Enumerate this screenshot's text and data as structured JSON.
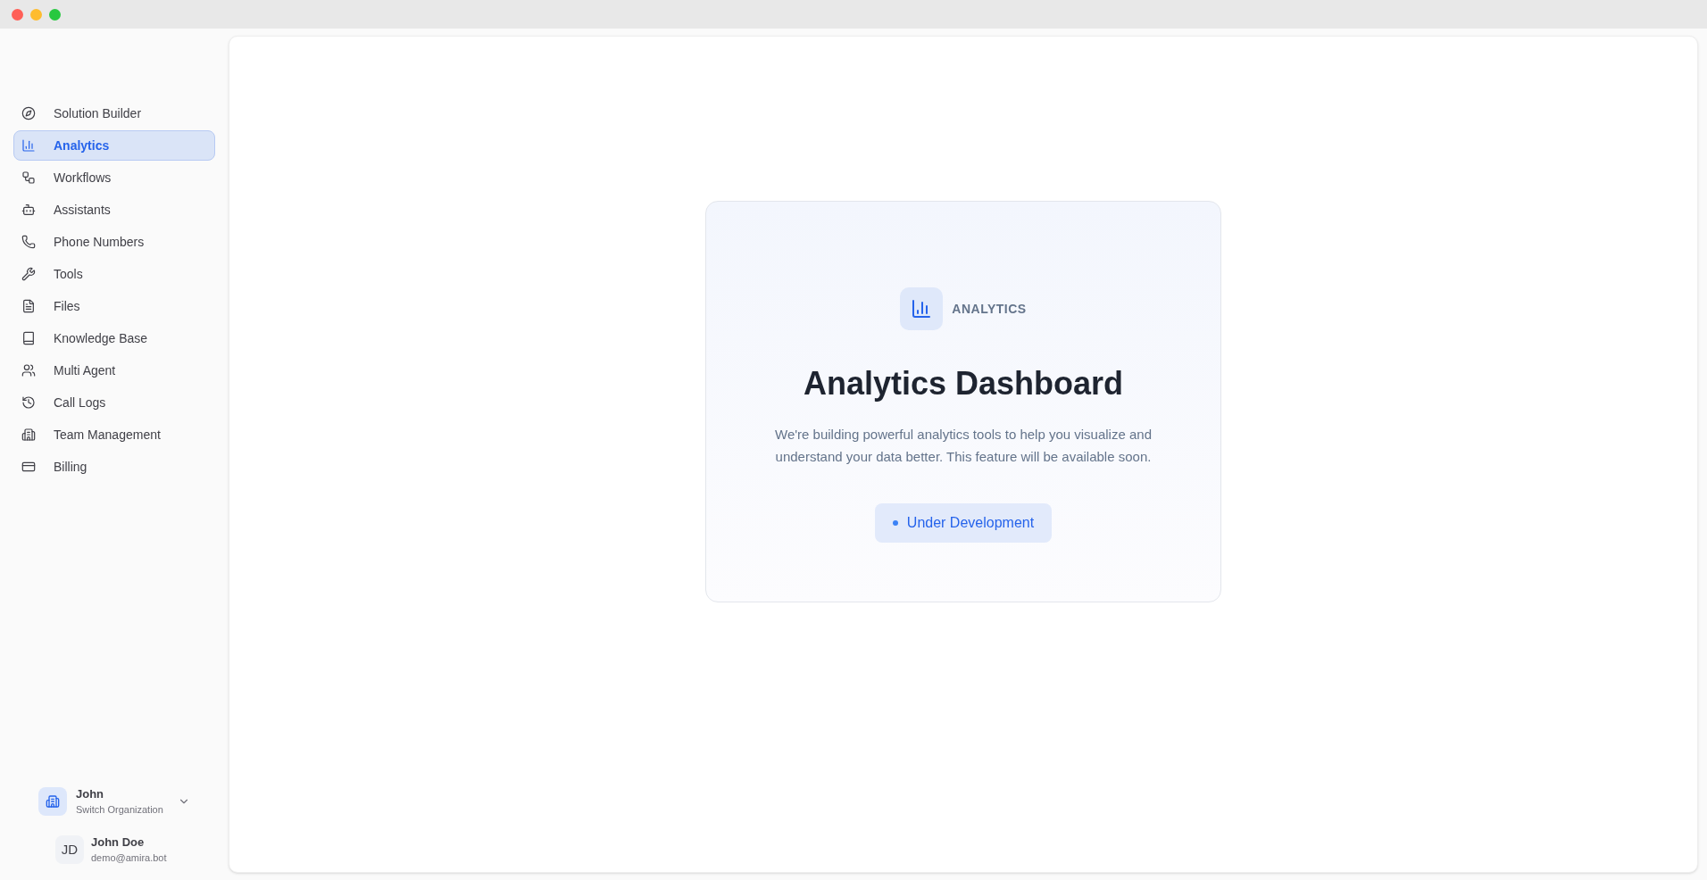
{
  "sidebar": {
    "items": [
      {
        "label": "Solution Builder",
        "selected": false
      },
      {
        "label": "Analytics",
        "selected": true
      },
      {
        "label": "Workflows",
        "selected": false
      },
      {
        "label": "Assistants",
        "selected": false
      },
      {
        "label": "Phone Numbers",
        "selected": false
      },
      {
        "label": "Tools",
        "selected": false
      },
      {
        "label": "Files",
        "selected": false
      },
      {
        "label": "Knowledge Base",
        "selected": false
      },
      {
        "label": "Multi Agent",
        "selected": false
      },
      {
        "label": "Call Logs",
        "selected": false
      },
      {
        "label": "Team Management",
        "selected": false
      },
      {
        "label": "Billing",
        "selected": false
      }
    ],
    "organization": {
      "name": "John",
      "action": "Switch Organization"
    },
    "user": {
      "initials": "JD",
      "name": "John Doe",
      "email": "demo@amira.bot"
    }
  },
  "main": {
    "eyebrow": "ANALYTICS",
    "title": "Analytics Dashboard",
    "description": "We're building powerful analytics tools to help you visualize and understand your data better. This feature will be available soon.",
    "status": "Under Development"
  }
}
